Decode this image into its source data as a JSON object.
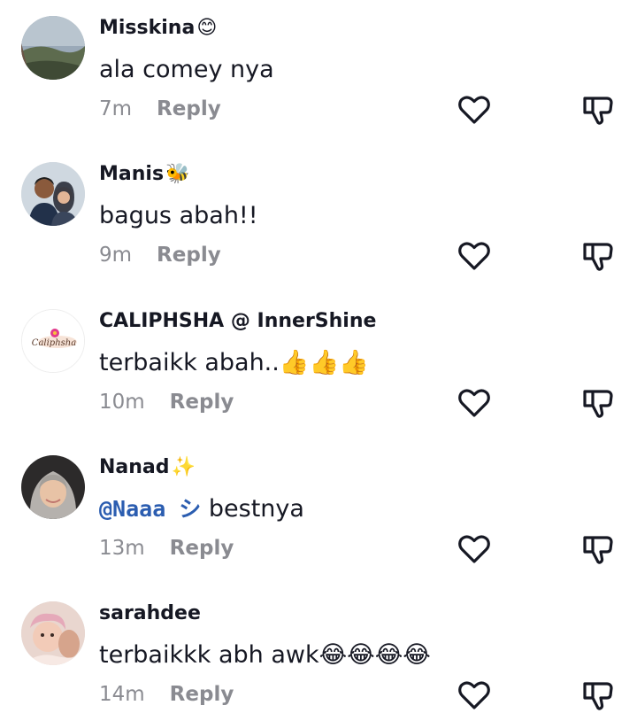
{
  "comments": [
    {
      "username": "Misskina",
      "badge": "😊",
      "text": "ala comey nya",
      "time": "7m",
      "reply": "Reply",
      "avatar_icon": "landscape-avatar"
    },
    {
      "username": "Manis",
      "badge": "🐝",
      "text": "bagus abah!!",
      "time": "9m",
      "reply": "Reply",
      "avatar_icon": "couple-avatar"
    },
    {
      "username": "CALIPHSHA @ InnerShine",
      "badge": "",
      "text": "terbaikk abah..👍👍👍",
      "time": "10m",
      "reply": "Reply",
      "avatar_icon": "logo-avatar",
      "avatar_logo_text": "Caliphsha"
    },
    {
      "username": "Nanad",
      "badge": "✨",
      "mention": "@Naaa シ",
      "text": " bestnya",
      "time": "13m",
      "reply": "Reply",
      "avatar_icon": "hijab-avatar"
    },
    {
      "username": "sarahdee",
      "badge": "",
      "text": "terbaikkk abh awk😂😂😂😂",
      "time": "14m",
      "reply": "Reply",
      "avatar_icon": "baby-avatar"
    }
  ],
  "icons": {
    "like": "heart-outline-icon",
    "dislike": "thumbs-down-outline-icon"
  },
  "colors": {
    "text": "#161823",
    "meta": "#8a8b91",
    "mention": "#2b5db0",
    "icon": "#161823"
  }
}
